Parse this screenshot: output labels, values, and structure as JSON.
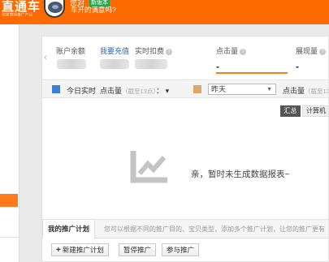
{
  "topbar": {
    "logo_text": "直通车",
    "logo_sub": "淘宝营销推广产品",
    "survey_question": "您对",
    "survey_badge": "新版本",
    "survey_text": "车开的满意吗?"
  },
  "account": {
    "balance_label": "账户余额",
    "recharge_link": "我要充值",
    "deduct_label": "实时扣费",
    "deduct_help": "?"
  },
  "metrics": [
    {
      "label": "点击量",
      "help": "?",
      "value": "-"
    },
    {
      "label": "展现量",
      "help": "?",
      "value": "-"
    }
  ],
  "toolbar": {
    "today_label": "今日实时",
    "metric_label": "点击量",
    "metric_note": "（截至13点）",
    "separator": "：",
    "compare_select": "昨天",
    "metric_label_2": "点击量",
    "metric_note_2": "（截至13"
  },
  "chart": {
    "summary_button": "汇总",
    "calc_button": "计算机",
    "empty_message": "亲，暂时未生成数据报表~"
  },
  "plans": {
    "tab_label": "我的推广计划",
    "hint": "您可以根据不同的推广目的、宝贝类型，添加多个推广计划，让您的推广更有"
  },
  "actions": {
    "new_plan": "新建推广计划",
    "pause": "暂停推广",
    "join": "参与推广"
  },
  "colors": {
    "brand_orange": "#ff6a00",
    "link_blue": "#2a64c8",
    "today_series": "#3b7ed8",
    "compare_series": "#d9a86a"
  }
}
